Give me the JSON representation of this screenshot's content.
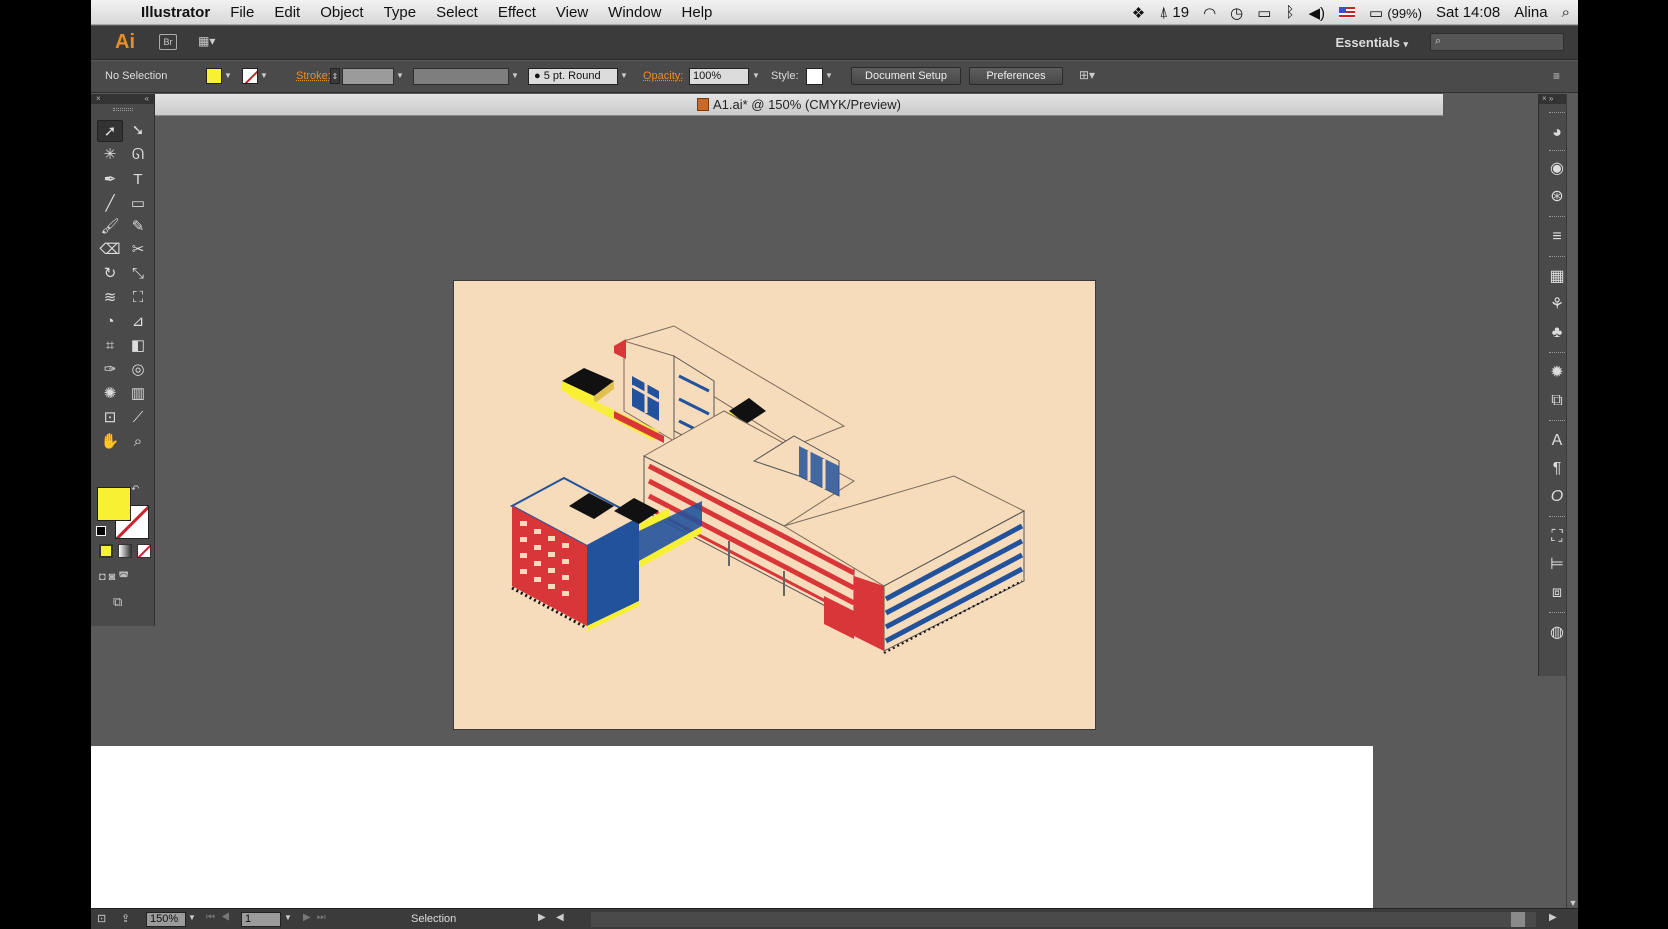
{
  "menubar": {
    "app_name": "Illustrator",
    "items": [
      "File",
      "Edit",
      "Object",
      "Type",
      "Select",
      "Effect",
      "View",
      "Window",
      "Help"
    ],
    "status": {
      "adobe_count": "19",
      "battery": "(99%)",
      "clock": "Sat 14:08",
      "user": "Alina"
    }
  },
  "appbar": {
    "logo": "Ai",
    "bridge": "Br",
    "workspace": "Essentials"
  },
  "control": {
    "selection": "No Selection",
    "stroke_label": "Stroke:",
    "brush": "5 pt. Round",
    "opacity_label": "Opacity:",
    "opacity_value": "100%",
    "style_label": "Style:",
    "document_setup": "Document Setup",
    "preferences": "Preferences"
  },
  "document": {
    "tab_title": "A1.ai* @ 150% (CMYK/Preview)"
  },
  "statusbar": {
    "zoom": "150%",
    "artboard": "1",
    "tool": "Selection"
  },
  "colors": {
    "fill": "#f8f032",
    "artboard": "#f7dcbb",
    "red": "#d9363a",
    "blue": "#23529c",
    "black": "#111111"
  },
  "tool_icons": [
    "selection-icon",
    "direct-selection-icon",
    "magic-wand-icon",
    "lasso-icon",
    "pen-icon",
    "type-icon",
    "line-icon",
    "rectangle-icon",
    "paintbrush-icon",
    "pencil-icon",
    "blob-brush-icon",
    "scissors-icon",
    "rotate-icon",
    "scale-icon",
    "warp-icon",
    "free-transform-icon",
    "shape-builder-icon",
    "perspective-grid-icon",
    "mesh-icon",
    "gradient-icon",
    "eyedropper-icon",
    "blend-icon",
    "symbol-sprayer-icon",
    "column-graph-icon",
    "artboard-icon",
    "slice-icon",
    "hand-icon",
    "zoom-icon"
  ],
  "dock_icons": [
    "color-icon",
    "color-guide-icon",
    "swatches-icon",
    "stroke-icon",
    "gradient-icon",
    "transparency-icon",
    "brushes-icon",
    "symbols-icon",
    "appearance-icon",
    "graphic-styles-icon",
    "character-icon",
    "paragraph-icon",
    "opentype-icon",
    "transform-icon",
    "align-icon",
    "pathfinder-icon",
    "layers-icon"
  ]
}
